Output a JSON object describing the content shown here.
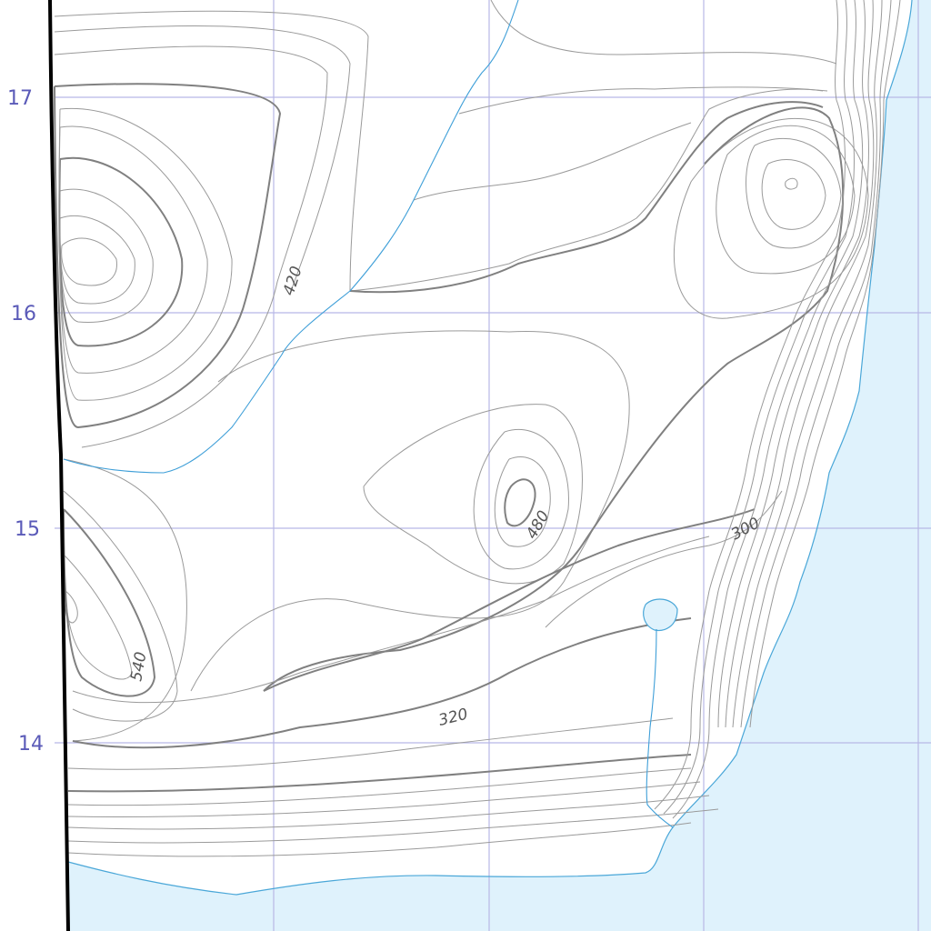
{
  "map": {
    "grid_labels": [
      "17",
      "16",
      "15",
      "14"
    ],
    "contour_labels": [
      "420",
      "480",
      "540",
      "320",
      "300"
    ],
    "colors": {
      "water": "#dff2fc",
      "land": "#ffffff",
      "grid": "#b8b8e6",
      "contour": "#9a9a9a",
      "index_contour": "#808080",
      "stream": "#3f9fd8",
      "grid_label": "#5a5ab8"
    }
  }
}
